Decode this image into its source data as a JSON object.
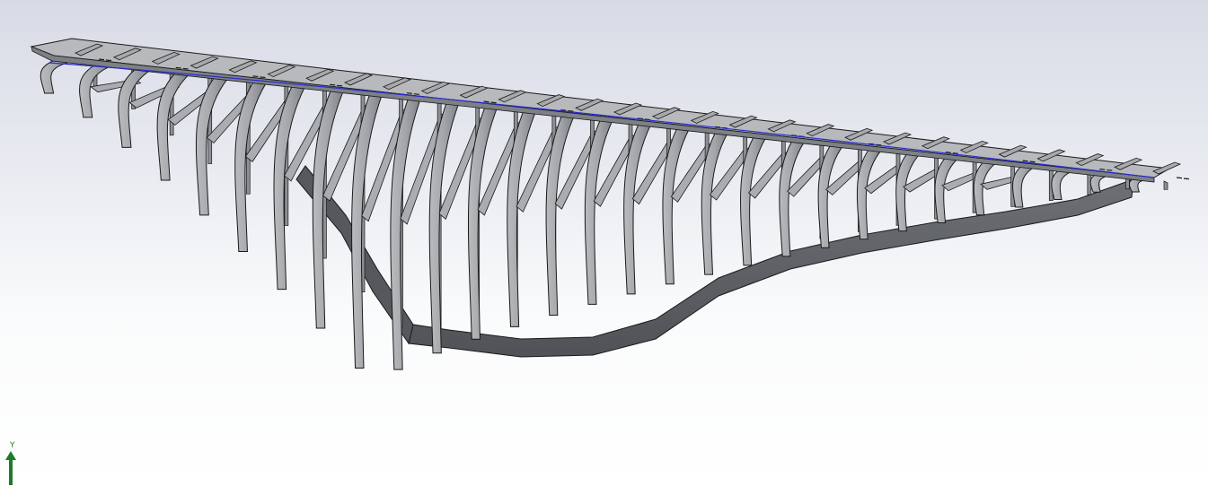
{
  "viewport": {
    "background_top": "#d8dbe6",
    "background_bottom": "#ffffff"
  },
  "model": {
    "description_icon": "ship-hull-frame-icon",
    "part_color": "#9c9fa3",
    "part_dark": "#5e6165",
    "part_light": "#c4c6c9",
    "edge_color": "#1a1a1a",
    "centerline_color": "#2b2bcf",
    "frame_count": 29
  },
  "triad": {
    "axis_label": "Y",
    "axis_color": "#1f7a2a",
    "icon": "y-axis-arrow-icon"
  }
}
